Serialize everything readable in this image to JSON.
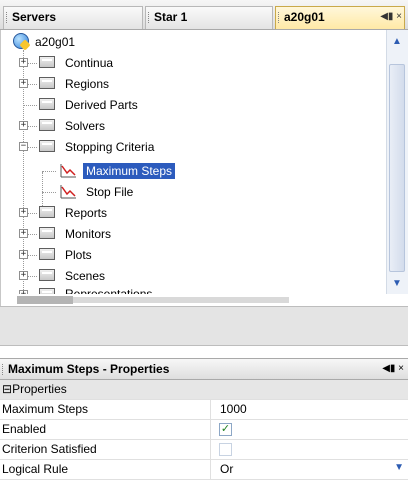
{
  "tabs": [
    {
      "label": "Servers",
      "active": false
    },
    {
      "label": "Star 1",
      "active": false
    },
    {
      "label": "a20g01",
      "active": true
    }
  ],
  "tab_controls": "◀▮ ×",
  "tree": {
    "root": "a20g01",
    "items": [
      {
        "label": "Continua",
        "expander": "+"
      },
      {
        "label": "Regions",
        "expander": "+"
      },
      {
        "label": "Derived Parts",
        "expander": ""
      },
      {
        "label": "Solvers",
        "expander": "+"
      },
      {
        "label": "Stopping Criteria",
        "expander": "−"
      },
      {
        "label": "Maximum Steps",
        "selected": true
      },
      {
        "label": "Stop File"
      },
      {
        "label": "Reports",
        "expander": "+"
      },
      {
        "label": "Monitors",
        "expander": "+"
      },
      {
        "label": "Plots",
        "expander": "+"
      },
      {
        "label": "Scenes",
        "expander": "+"
      },
      {
        "label": "Representations",
        "expander": "+"
      }
    ]
  },
  "properties": {
    "title": "Maximum Steps - Properties",
    "controls": "◀▮ ×",
    "group": "Properties",
    "group_expander": "⊟",
    "rows": [
      {
        "name": "Maximum Steps",
        "value": "1000"
      },
      {
        "name": "Enabled",
        "checked": true
      },
      {
        "name": "Criterion Satisfied",
        "checked": false
      },
      {
        "name": "Logical Rule",
        "value": "Or"
      }
    ]
  },
  "icons": {
    "check": "✓",
    "scroll_up": "▲",
    "scroll_down": "▼",
    "dropdown": "▼"
  },
  "colors": {
    "selection": "#2c5bbd",
    "active_tab": "#ffe9a6"
  }
}
